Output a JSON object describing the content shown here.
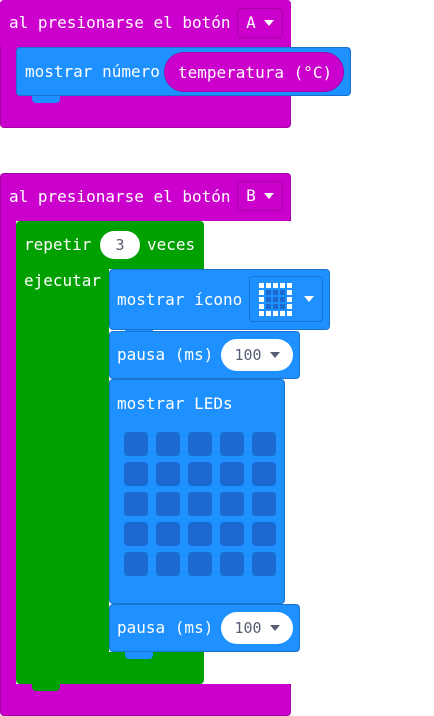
{
  "event_a": {
    "label": "al presionarse el botón",
    "button": "A"
  },
  "show_number": {
    "label": "mostrar número",
    "reporter": "temperatura (°C)"
  },
  "event_b": {
    "label": "al presionarse el botón",
    "button": "B"
  },
  "repeat": {
    "label_before": "repetir",
    "count": "3",
    "label_after": "veces",
    "do_label": "ejecutar"
  },
  "show_icon": {
    "label": "mostrar ícono"
  },
  "pause1": {
    "label": "pausa (ms)",
    "value": "100"
  },
  "show_leds": {
    "label": "mostrar LEDs"
  },
  "pause2": {
    "label": "pausa (ms)",
    "value": "100"
  },
  "colors": {
    "event": "#cc00cc",
    "basic": "#1e90ff",
    "loop": "#00a000",
    "led_off": "#1c6ad0"
  }
}
